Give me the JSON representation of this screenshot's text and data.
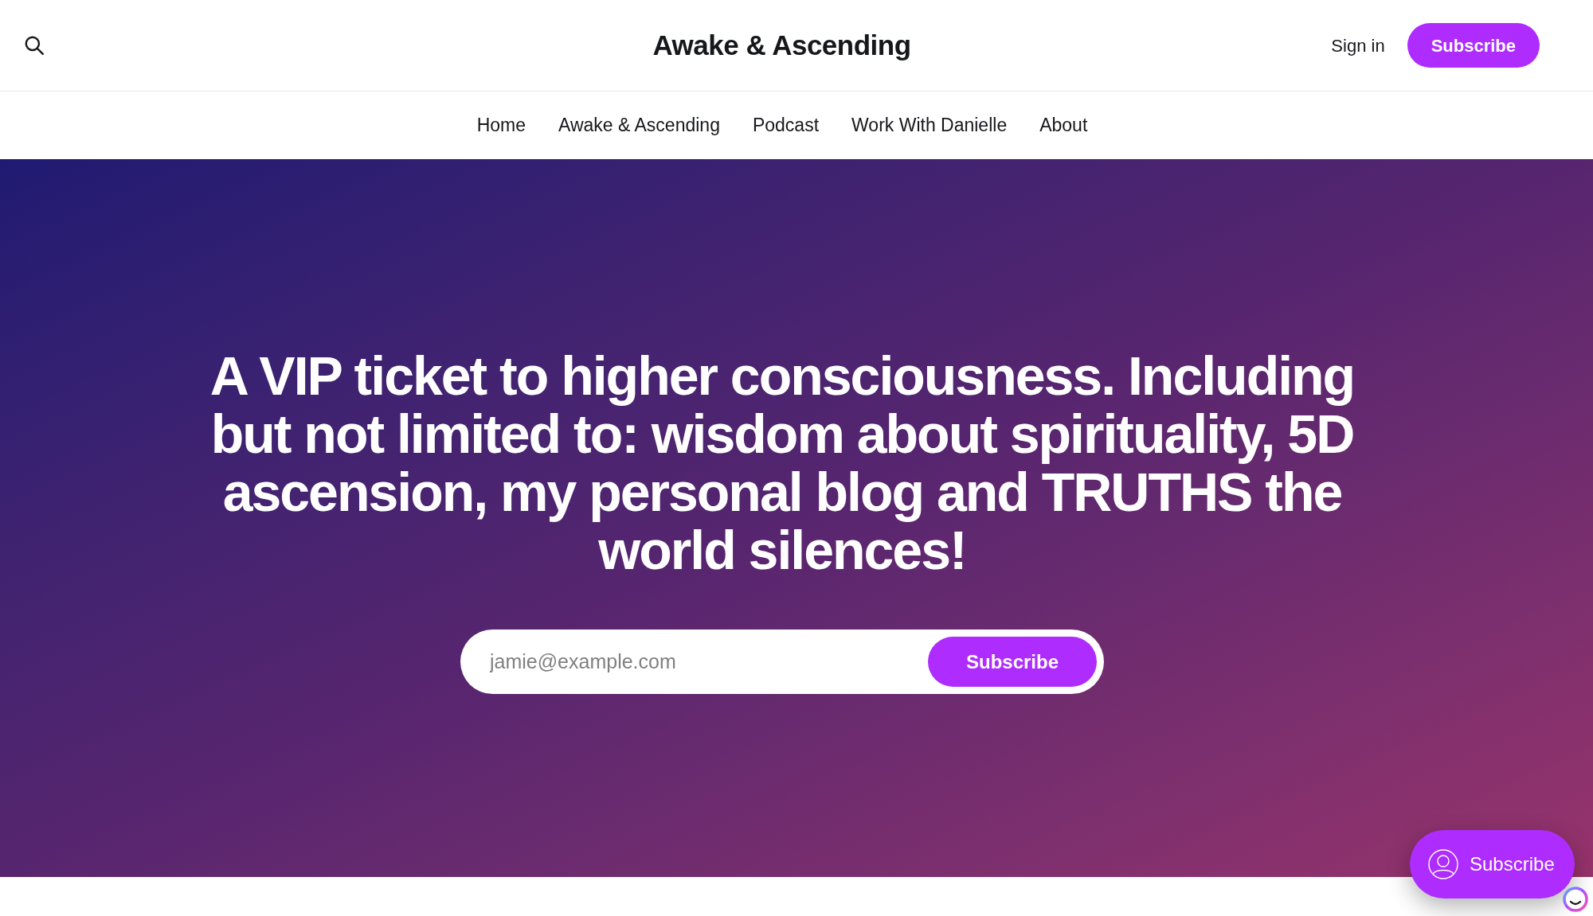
{
  "header": {
    "title": "Awake & Ascending",
    "sign_in": "Sign in",
    "subscribe_button": "Subscribe"
  },
  "nav": [
    "Home",
    "Awake & Ascending",
    "Podcast",
    "Work With Danielle",
    "About"
  ],
  "hero": {
    "headline": "A VIP ticket to higher consciousness. Including but not limited to: wisdom about spirituality, 5D ascension, my personal blog and TRUTHS the world silences!",
    "email_field": {
      "placeholder": "jamie@example.com"
    },
    "subscribe_button": "Subscribe"
  },
  "floating_subscribe": {
    "label": "Subscribe"
  }
}
